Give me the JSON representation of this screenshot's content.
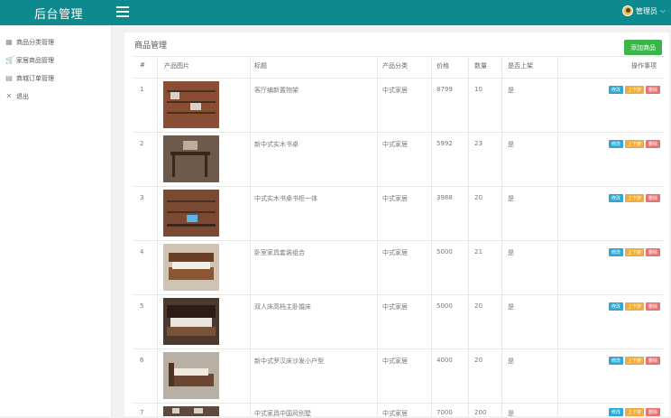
{
  "header": {
    "brand": "后台管理",
    "username": "管理员"
  },
  "sidebar": {
    "items": [
      {
        "label": "商品分类管理",
        "icon": "grid-icon"
      },
      {
        "label": "家居商品管理",
        "icon": "cart-icon"
      },
      {
        "label": "商城订单管理",
        "icon": "document-icon"
      },
      {
        "label": "退出",
        "icon": "close-icon"
      }
    ]
  },
  "main": {
    "title": "商品管理",
    "add_button": "添加商品",
    "columns": [
      "#",
      "产品图片",
      "标题",
      "产品分类",
      "价格",
      "数量",
      "是否上架",
      "操作事项"
    ],
    "actions": {
      "edit": "修改",
      "toggle": "上下架",
      "delete": "删除"
    },
    "rows": [
      {
        "id": "1",
        "title": "客厅编新置物架",
        "category": "中式家居",
        "price": "8799",
        "qty": "10",
        "listed": "是"
      },
      {
        "id": "2",
        "title": "新中式实木书桌",
        "category": "中式家居",
        "price": "5992",
        "qty": "23",
        "listed": "是"
      },
      {
        "id": "3",
        "title": "中式实木书桌书柜一体",
        "category": "中式家居",
        "price": "3988",
        "qty": "20",
        "listed": "是"
      },
      {
        "id": "4",
        "title": "卧室家具套装组合",
        "category": "中式家居",
        "price": "5000",
        "qty": "21",
        "listed": "是"
      },
      {
        "id": "5",
        "title": "双人床高档主卧婚床",
        "category": "中式家居",
        "price": "5000",
        "qty": "20",
        "listed": "是"
      },
      {
        "id": "6",
        "title": "新中式罗汉床沙发小户型",
        "category": "中式家居",
        "price": "4000",
        "qty": "20",
        "listed": "是"
      },
      {
        "id": "7",
        "title": "中式家具中国风别墅",
        "category": "中式家居",
        "price": "7000",
        "qty": "200",
        "listed": "是"
      }
    ]
  }
}
